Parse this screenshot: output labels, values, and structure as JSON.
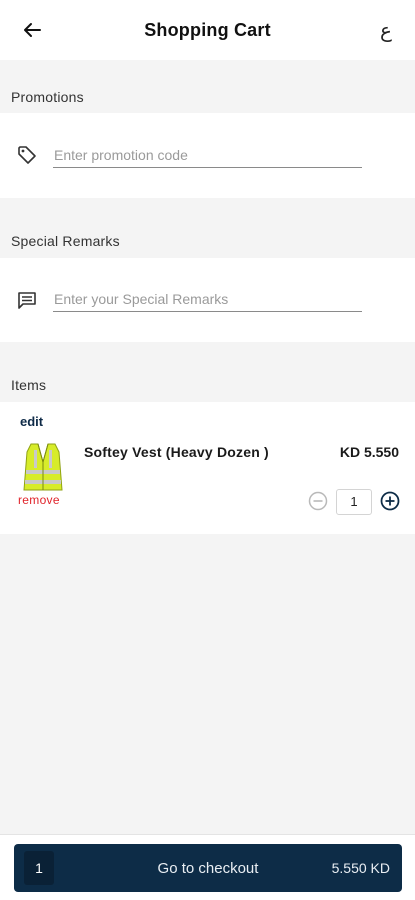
{
  "header": {
    "title": "Shopping Cart",
    "back_icon": "back-arrow-icon",
    "language_toggle": "ع"
  },
  "promotions": {
    "label": "Promotions",
    "icon": "tag-icon",
    "placeholder": "Enter promotion code",
    "value": ""
  },
  "remarks": {
    "label": "Special Remarks",
    "icon": "comment-icon",
    "placeholder": "Enter your Special Remarks",
    "value": ""
  },
  "items": {
    "label": "Items",
    "list": [
      {
        "edit_label": "edit",
        "remove_label": "remove",
        "name": "Softey Vest (Heavy Dozen )",
        "price": "KD 5.550",
        "quantity": "1",
        "image_icon": "safety-vest-image"
      }
    ]
  },
  "checkout": {
    "count": "1",
    "label": "Go to checkout",
    "total": "5.550 KD"
  },
  "colors": {
    "primary": "#0d2c47",
    "remove": "#e0242b",
    "background": "#f4f4f4"
  }
}
